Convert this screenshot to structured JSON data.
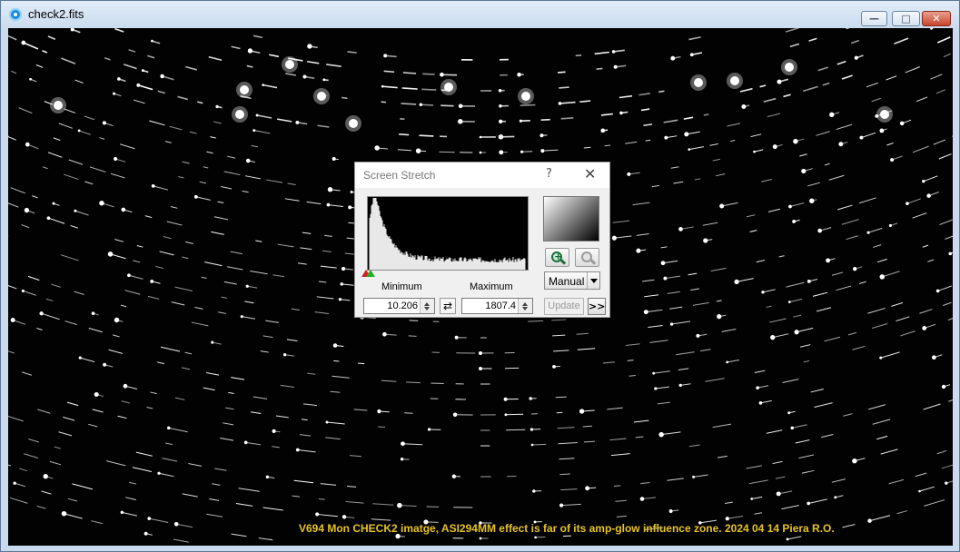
{
  "window": {
    "title": "check2.fits",
    "minimize_icon": "minimize-icon",
    "maximize_icon": "maximize-icon",
    "close_icon": "close-icon",
    "minimize_glyph": "—",
    "maximize_glyph": "□",
    "close_glyph": "✕"
  },
  "image": {
    "caption": "V694 Mon CHECK2 imatge, ASI294MM effect is far of its amp-glow influence zone.  2024 04 14 Piera R.O."
  },
  "dialog": {
    "title": "Screen Stretch",
    "help_glyph": "?",
    "close_glyph": "✕",
    "minimum_label": "Minimum",
    "maximum_label": "Maximum",
    "minimum_value": "10.206",
    "maximum_value": "1807.4",
    "swap_glyph": "⇄",
    "mode_value": "Manual",
    "update_label": "Update",
    "more_label": ">>",
    "zoom_in_icon": "zoom-in-icon",
    "zoom_out_icon": "zoom-out-icon",
    "colors": {
      "caption": "#e6c325",
      "min_marker": "#d42020",
      "max_marker": "#1fae2e"
    }
  }
}
